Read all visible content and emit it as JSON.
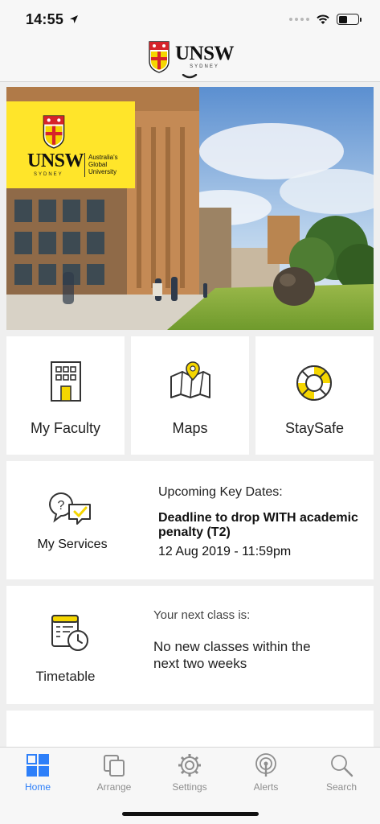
{
  "status": {
    "time": "14:55"
  },
  "header": {
    "logo": "UNSW",
    "logo_sub": "SYDNEY"
  },
  "hero": {
    "badge_logo": "UNSW",
    "badge_sub": "SYDNEY",
    "badge_tagline": "Australia's Global University"
  },
  "tiles": [
    {
      "label": "My Faculty",
      "icon": "building-icon"
    },
    {
      "label": "Maps",
      "icon": "map-pin-icon"
    },
    {
      "label": "StaySafe",
      "icon": "lifebuoy-icon"
    }
  ],
  "services": {
    "label": "My Services",
    "key_dates_heading": "Upcoming Key Dates:",
    "event_title": "Deadline to drop WITH academic penalty (T2)",
    "event_date": "12 Aug 2019 - 11:59pm"
  },
  "timetable": {
    "label": "Timetable",
    "next_class_heading": "Your next class is:",
    "next_class_value": "No new classes within the next two weeks"
  },
  "tab_bar": {
    "tabs": [
      {
        "label": "Home",
        "icon": "grid-icon",
        "active": true
      },
      {
        "label": "Arrange",
        "icon": "copy-icon",
        "active": false
      },
      {
        "label": "Settings",
        "icon": "gear-icon",
        "active": false
      },
      {
        "label": "Alerts",
        "icon": "broadcast-icon",
        "active": false
      },
      {
        "label": "Search",
        "icon": "search-icon",
        "active": false
      }
    ]
  },
  "colors": {
    "accent": "#2d7ff9",
    "brand_yellow": "#ffe52a",
    "background": "#efefef"
  }
}
